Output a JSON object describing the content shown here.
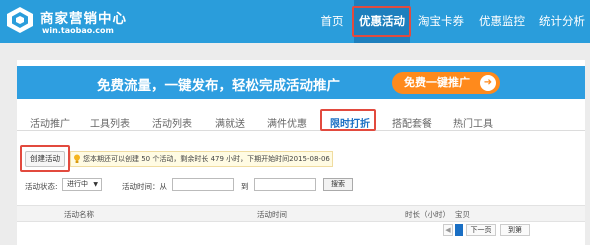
{
  "header": {
    "brand_title": "商家营销中心",
    "brand_url": "win.taobao.com",
    "nav": [
      "首页",
      "优惠活动",
      "淘宝卡券",
      "优惠监控",
      "统计分析"
    ],
    "active_nav": "优惠活动"
  },
  "banner": {
    "text": "免费流量，一键发布，轻松完成活动推广",
    "button_label": "免费一键推广"
  },
  "tabs": [
    "活动推广",
    "工具列表",
    "活动列表",
    "满就送",
    "满件优惠",
    "限时打折",
    "搭配套餐",
    "热门工具"
  ],
  "active_tab": "限时打折",
  "create_button": "创建活动",
  "notice": "您本期还可以创建 50 个活动，剩余时长 479 小时，下期开始时间2015-08-06",
  "filters": {
    "status_label": "活动状态:",
    "status_value": "进行中",
    "time_label": "活动时间：从",
    "to_label": "到",
    "search_label": "搜索"
  },
  "table_headers": [
    "活动名称",
    "活动时间",
    "时长（小时）",
    "宝贝"
  ],
  "pager": {
    "next": "下一页",
    "number": "到第"
  },
  "colors": {
    "topbar": "#2a9ddb",
    "highlight": "#e24a3e",
    "accent": "#ff8a1c"
  }
}
